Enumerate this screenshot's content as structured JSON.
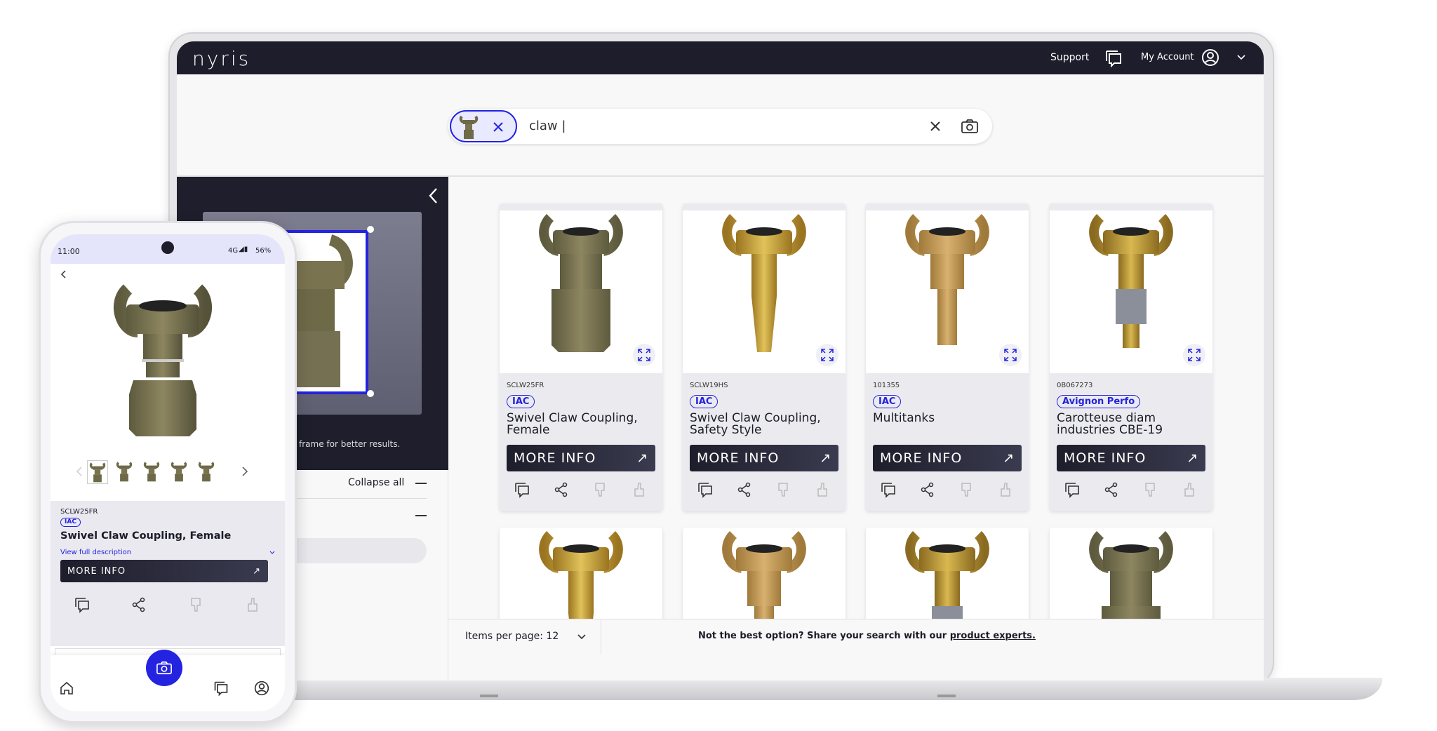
{
  "app": {
    "logo": "nyris",
    "support": "Support",
    "account": "My Account"
  },
  "search": {
    "query": "claw |",
    "icons": [
      "close-icon",
      "camera-icon"
    ]
  },
  "left_panel": {
    "hint": "frame for better results.",
    "collapse_all": "Collapse all"
  },
  "results": [
    {
      "sku": "SCLW25FR",
      "brand": "IAC",
      "title": "Swivel Claw Coupling, Female",
      "more": "MORE INFO"
    },
    {
      "sku": "SCLW19HS",
      "brand": "IAC",
      "title": "Swivel Claw Coupling, Safety Style",
      "more": "MORE INFO"
    },
    {
      "sku": "101355",
      "brand": "IAC",
      "title": "Multitanks",
      "more": "MORE INFO"
    },
    {
      "sku": "0B067273",
      "brand": "Avignon Perfo",
      "title": "Carotteuse diam industries CBE-19",
      "more": "MORE INFO"
    }
  ],
  "footer": {
    "items_per_page": "Items per page: 12",
    "note": "Not the best option? Share your search with our ",
    "link": "product experts."
  },
  "phone": {
    "time": "11:00",
    "network": "4G",
    "battery": "56%",
    "sku": "SCLW25FR",
    "brand": "IAC",
    "title": "Swivel Claw Coupling, Female",
    "desc_link": "View full description",
    "more": "MORE INFO"
  },
  "colors": {
    "accent": "#2323e0",
    "nav": "#1d1d2b",
    "brass": "#c9a23a",
    "bronze": "#7a7350"
  }
}
